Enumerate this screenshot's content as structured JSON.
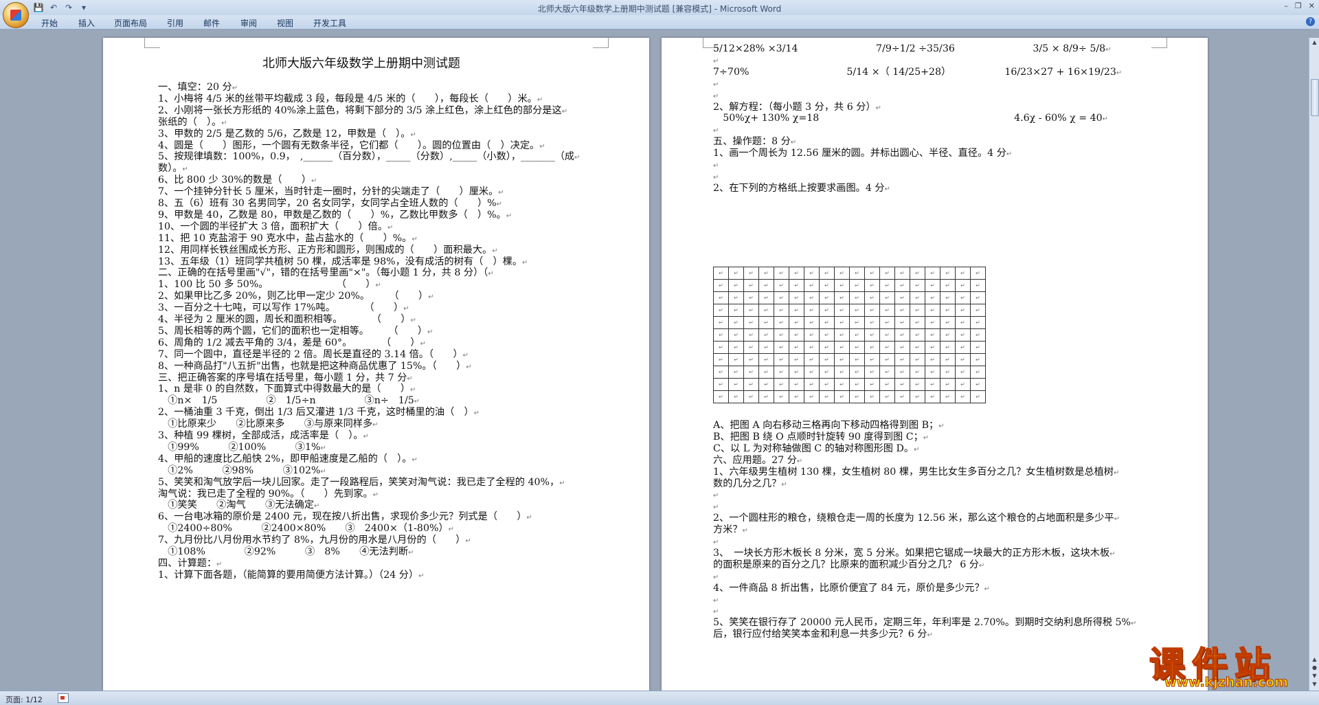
{
  "window": {
    "title": "北师大版六年级数学上册期中测试题 [兼容模式] - Microsoft Word",
    "controls": [
      "–",
      "❐",
      "✕"
    ]
  },
  "ribbon": {
    "tabs": [
      "开始",
      "插入",
      "页面布局",
      "引用",
      "邮件",
      "审阅",
      "视图",
      "开发工具"
    ]
  },
  "statusbar": {
    "page": "页面: 1/12"
  },
  "page1": {
    "title": "北师大版六年级数学上册期中测试题",
    "lines": [
      "一、填空：20 分",
      "1、小梅将 4/5 米的丝带平均截成 3 段，每段是 4/5 米的（　　），每段长（　　）米。",
      "2、小刚将一张长方形纸的 40%涂上蓝色，将剩下部分的 3/5 涂上红色，涂上红色的部分是这",
      "张纸的（　）。",
      "3、甲数的 2/5 是乙数的 5/6，乙数是 12，甲数是（　）。",
      "4、圆是（　　）图形，一个圆有无数条半径，它们都（　　）。圆的位置由（　）决定。",
      "5、按规律填数：100%，0.9，　,______（百分数），_____（分数）,_____（小数），_______（成",
      "数）。",
      "6、比 800 少 30%的数是（　　）",
      "7、一个挂钟分针长 5 厘米，当时针走一圈时，分针的尖端走了（　　）厘米。",
      "8、五（6）班有 30 名男同学，20 名女同学，女同学占全班人数的（　　）%",
      "9、甲数是 40，乙数是 80，甲数是乙数的（　　）%，乙数比甲数多（　）%。",
      "10、一个圆的半径扩大 3 倍，面积扩大（　　）倍。",
      "11、把 10 克盐溶于 90 克水中，盐占盐水的（　　）%。",
      "12、用同样长铁丝围成长方形、正方形和圆形，则围成的（　　）面积最大。",
      "13、五年级（1）班同学共植树 50 棵，成活率是 98%，没有成活的树有（　）棵。",
      "二、正确的在括号里画\"√\"，错的在括号里画\"×\"。（每小题 1 分，共 8 分）（",
      "1、100 比 50 多 50%。　　　　　　　　（　　）",
      "2、如果甲比乙多 20%，则乙比甲一定少 20%。　　　（　　）",
      "3、一百分之十七吨，可以写作 17%吨。　　　　（　　）",
      "4、半径为 2 厘米的圆，周长和面积相等。　　　　（　　）",
      "5、周长相等的两个圆，它们的面积也一定相等。　　　（　　）",
      "6、周角的 1/2 减去平角的 3/4，差是 60°。　　　　（　　）",
      "7、同一个圆中，直径是半径的 2 倍。周长是直径的 3.14 倍。（　　）",
      "8、一种商品打\"八五折\"出售，也就是把这种商品优惠了 15%。（　　）",
      "三、把正确答案的序号填在括号里，每小题 1 分，共 7 分",
      "1、n 是非 0 的自然数，下面算式中得数最大的是（　　）",
      "　①n×　1/5　　　　　②　1/5÷n　　　　　③n÷　1/5",
      "2、一桶油重 3 千克，倒出 1/3 后又灌进 1/3 千克，这时桶里的油（　）",
      "　①比原来少　　②比原来多　　③与原来同样多",
      "3、种植 99 棵树，全部成活，成活率是（　）。",
      "　①99%　　　②100%　　　③1%",
      "4、甲船的速度比乙船快 2%，即甲船速度是乙船的（　）。",
      "　①2%　　　②98%　　　③102%",
      "5、笑笑和淘气放学后一块儿回家。走了一段路程后，笑笑对淘气说：我已走了全程的 40%，",
      "淘气说：我已走了全程的 90%。（　　）先到家。",
      "　①笑笑　　②淘气　　③无法确定",
      "6、一台电冰箱的原价是 2400 元，现在按八折出售，求现价多少元？列式是（　　）",
      "　①2400÷80%　　　②2400×80%　　③　2400×（1-80%）",
      "7、九月份比八月份用水节约了 8%，九月份的用水是八月份的（　　）",
      "　①108%　　　　②92%　　　③　8%　　④无法判断",
      "四、计算题：",
      "1、计算下面各题，（能简算的要用简便方法计算。）（24 分）"
    ]
  },
  "page2": {
    "lines": [
      "5/12×28% ×3/14　　　　　　　　7/9÷1/2 ÷35/36　　　　　　　　3/5 × 8/9÷ 5/8",
      "",
      " 7÷70%　　　　　　　　　　5/14 ×（ 14/25+28）　　　　　　16/23×27 + 16×19/23",
      "",
      "",
      "2、解方程：（每小题 3 分，共 6 分）",
      "　50%χ+ 130% χ=18　　　　　　　　　　　　　　　　　　　　4.6χ - 60% χ = 40",
      "",
      "五、操作题：8 分",
      "1、画一个周长为 12.56 厘米的圆。并标出圆心、半径、直径。4 分",
      "",
      "",
      "2、在下列的方格纸上按要求画图。4 分"
    ],
    "lines_after_grid": [
      "A、把图 A 向右移动三格再向下移动四格得到图 B；",
      "B、把图 B 绕 O 点顺时针旋转 90 度得到图 C；",
      "C、以 L 为对称轴做图 C 的轴对称图形图 D。",
      "六、应用题。27 分",
      "1、六年级男生植树 130 棵，女生植树 80 棵，男生比女生多百分之几？女生植树数是总植树",
      "数的几分之几？",
      "",
      "",
      " 2、一个圆柱形的粮仓，绕粮仓走一周的长度为 12.56 米，那么这个粮仓的占地面积是多少平",
      "方米？",
      "",
      "3、　一块长方形木板长 8 分米，宽 5 分米。如果把它锯成一块最大的正方形木板，这块木板",
      "的面积是原来的百分之几？比原来的面积减少百分之几？ 6 分",
      "",
      " 4、一件商品 8 折出售，比原价便宜了 84 元，原价是多少元？",
      "",
      "",
      "5、笑笑在银行存了 20000 元人民币，定期三年，年利率是 2.70%。到期时交纳利息所得税 5%",
      "后，银行应付给笑笑本金和利息一共多少元？6 分"
    ],
    "grid": {
      "rows": 11,
      "cols": 18
    }
  },
  "watermark": {
    "text": "课件站",
    "url": "www.kjzhan.com"
  }
}
